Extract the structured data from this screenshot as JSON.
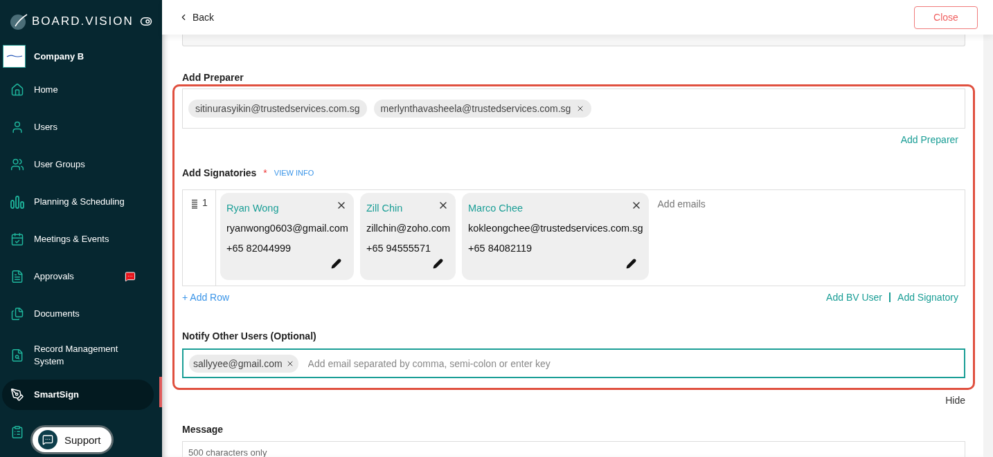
{
  "sidebar": {
    "brand": "BOARD.VISION",
    "company": {
      "name": "Company B"
    },
    "items": [
      {
        "label": "Home",
        "kind": "home",
        "selected": false
      },
      {
        "label": "Users",
        "kind": "user",
        "selected": false
      },
      {
        "label": "User Groups",
        "kind": "users",
        "selected": false
      },
      {
        "label": "Planning & Scheduling",
        "kind": "bars",
        "selected": false
      },
      {
        "label": "Meetings & Events",
        "kind": "calendar",
        "selected": false
      },
      {
        "label": "Approvals",
        "kind": "doc",
        "selected": false,
        "badge": true
      },
      {
        "label": "Documents",
        "kind": "docs",
        "selected": false
      },
      {
        "label": "Record Management System",
        "kind": "record",
        "selected": false
      },
      {
        "label": "SmartSign",
        "kind": "sign",
        "selected": true
      },
      {
        "kind": "survey",
        "selected": false
      }
    ],
    "support": "Support"
  },
  "header": {
    "back": "Back",
    "close": "Close"
  },
  "preparer": {
    "label": "Add Preparer",
    "chips": [
      {
        "email": "sitinurasyikin@trustedservices.com.sg",
        "removable": false
      },
      {
        "email": "merlynthavasheela@trustedservices.com.sg",
        "removable": true
      }
    ],
    "add_link": "Add Preparer"
  },
  "signatories": {
    "label": "Add Signatories",
    "required_mark": "*",
    "info_link": "VIEW INFO",
    "rows": [
      {
        "number": "1",
        "placeholder": "Add emails",
        "cards": [
          {
            "name": "Ryan Wong",
            "email": "ryanwong0603@gmail.com",
            "phone": "+65 82044999"
          },
          {
            "name": "Zill Chin",
            "email": "zillchin@zoho.com",
            "phone": "+65 94555571"
          },
          {
            "name": "Marco Chee",
            "email": "kokleongchee@trustedservices.com.sg",
            "phone": "+65 84082119"
          }
        ]
      }
    ],
    "add_row": "+ Add Row",
    "links": [
      "Add BV User",
      "Add Signatory"
    ]
  },
  "notify": {
    "label": "Notify Other Users (Optional)",
    "focused": true,
    "chips": [
      {
        "email": "sallyyee@gmail.com",
        "removable": true
      }
    ],
    "placeholder": "Add email separated by comma, semi-colon or enter key"
  },
  "hide": "Hide",
  "message": {
    "label": "Message",
    "placeholder": "500 characters only"
  }
}
